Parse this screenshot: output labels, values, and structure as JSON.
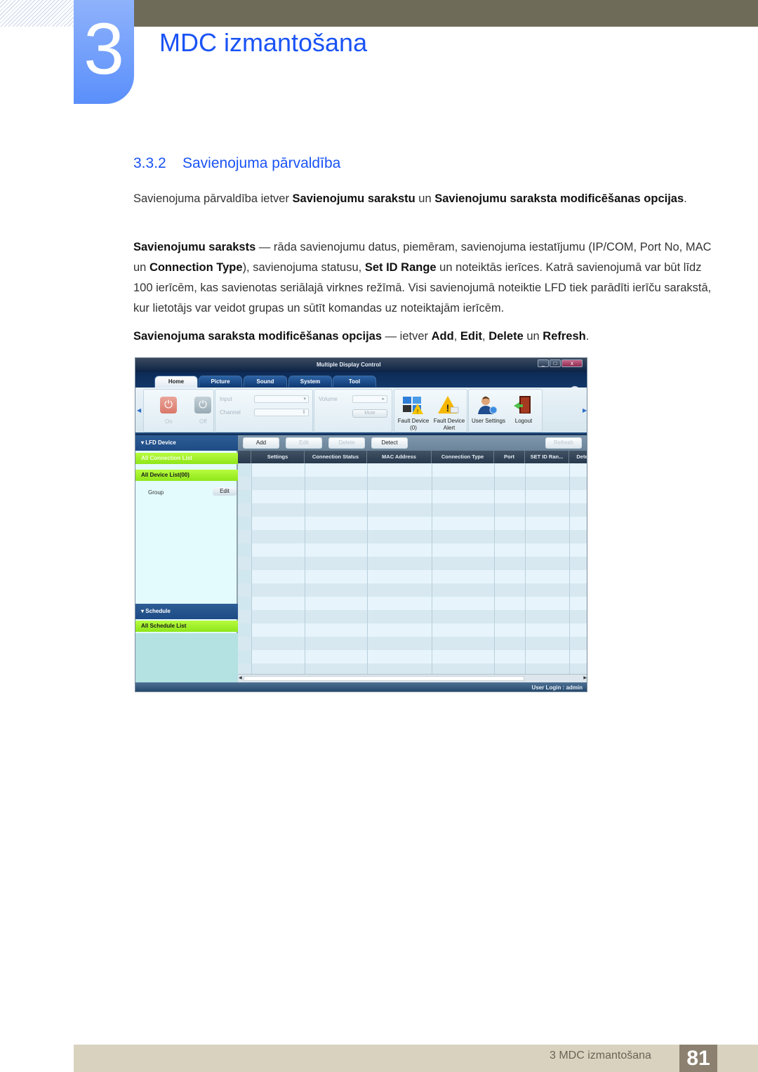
{
  "chapter": {
    "number": "3",
    "title": "MDC izmantošana"
  },
  "section": {
    "number": "3.3.2",
    "title": "Savienojuma pārvaldība"
  },
  "paragraphs": {
    "p1": {
      "t1": "Savienojuma pārvaldība ietver ",
      "b1": "Savienojumu sarakstu",
      "t2": " un ",
      "b2": "Savienojumu saraksta modificēšanas opcijas",
      "t3": "."
    },
    "p2": {
      "b1": "Savienojumu saraksts",
      "t1": " — rāda savienojumu datus, piemēram, savienojuma iestatījumu (IP/COM, Port No, MAC un ",
      "b2": "Connection Type",
      "t2": "), savienojuma statusu, ",
      "b3": "Set ID Range",
      "t3": " un noteiktās ierīces. Katrā savienojumā var būt līdz 100 ierīcēm, kas savienotas seriālajā virknes režīmā. Visi savienojumā noteiktie LFD tiek parādīti ierīču sarakstā, kur lietotājs var veidot grupas un sūtīt komandas uz noteiktajām ierīcēm."
    },
    "p3": {
      "b1": "Savienojuma saraksta modificēšanas opcijas",
      "t1": " — ietver ",
      "b2": "Add",
      "t2": ", ",
      "b3": "Edit",
      "t3": ", ",
      "b4": "Delete",
      "t4": " un ",
      "b5": "Refresh",
      "t5": "."
    }
  },
  "app": {
    "title": "Multiple Display Control",
    "window_buttons": {
      "minimize": "_",
      "maximize": "□",
      "close": "x"
    },
    "help": "?",
    "tabs": [
      "Home",
      "Picture",
      "Sound",
      "System",
      "Tool"
    ],
    "active_tab": "Home",
    "ribbon": {
      "power_on": "On",
      "power_off": "Off",
      "input_label": "Input",
      "channel_label": "Channel",
      "volume_label": "Volume",
      "mute": "Mute",
      "fault_device": "Fault Device",
      "fault_device_count": "(0)",
      "fault_device_alert_1": "Fault Device",
      "fault_device_alert_2": "Alert",
      "user_settings": "User Settings",
      "logout": "Logout"
    },
    "left_panel": {
      "lfd_device": "LFD Device",
      "all_connection_list": "All Connection List",
      "all_device_list": "All Device List(00)",
      "group": "Group",
      "group_edit": "Edit",
      "schedule": "Schedule",
      "all_schedule_list": "All Schedule List"
    },
    "toolbar": {
      "add": "Add",
      "edit": "Edit",
      "delete": "Delete",
      "detect": "Detect",
      "refresh": "Refresh"
    },
    "grid": {
      "columns": [
        "Settings",
        "Connection Status",
        "MAC Address",
        "Connection Type",
        "Port",
        "SET ID Ran...",
        "Dete"
      ],
      "rows": []
    },
    "status": "User Login : admin"
  },
  "footer": {
    "chapter_label": "3 MDC izmantošana",
    "page": "81"
  },
  "colors": {
    "accent_blue": "#1a53f5",
    "chapter_box": "#5a8ffb",
    "top_bar": "#6e6b58",
    "footer_bar": "#d9d2bf",
    "page_box": "#8c8070",
    "selection_green": "#9be82a"
  }
}
